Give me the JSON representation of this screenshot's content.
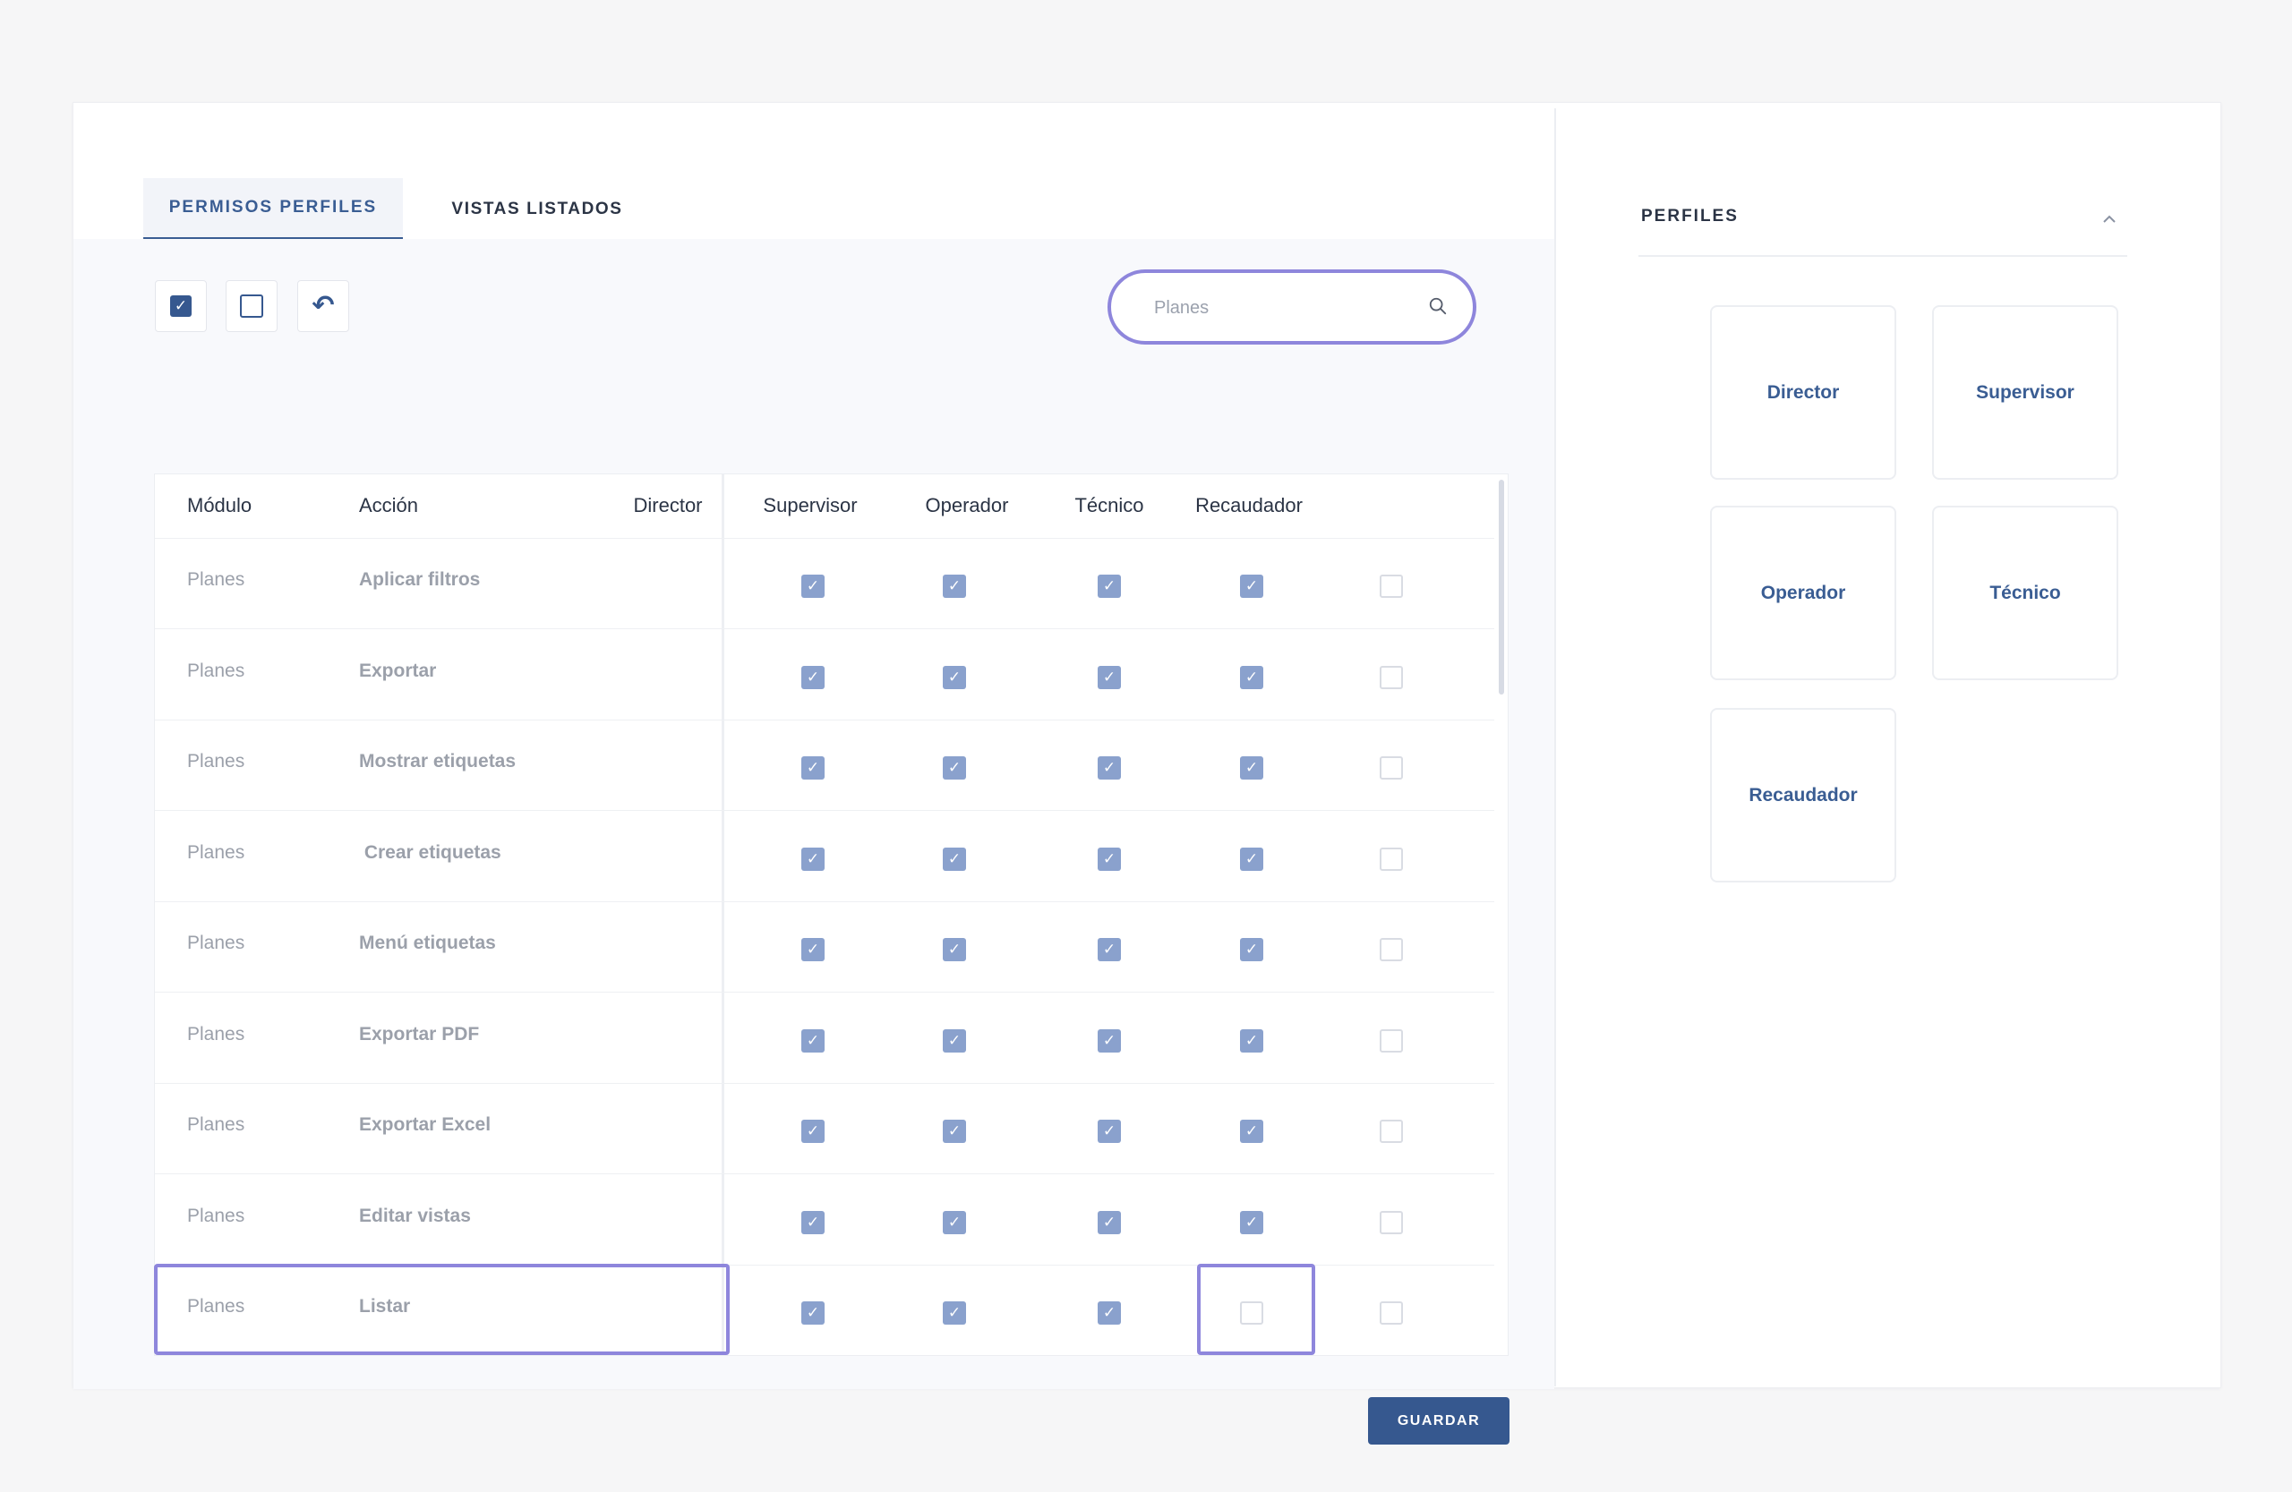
{
  "tabs": {
    "permisos": "PERMISOS PERFILES",
    "vistas": "VISTAS LISTADOS"
  },
  "toolbar": {
    "check_all": "✓",
    "uncheck_all": "",
    "undo": "↶"
  },
  "search": {
    "value": "",
    "placeholder": "Planes"
  },
  "table": {
    "headers": {
      "modulo": "Módulo",
      "accion": "Acción"
    },
    "profiles": [
      "Director",
      "Supervisor",
      "Operador",
      "Técnico",
      "Recaudador"
    ],
    "rows": [
      {
        "modulo": "Planes",
        "accion": "Aplicar filtros",
        "perms": [
          true,
          true,
          true,
          true,
          false
        ]
      },
      {
        "modulo": "Planes",
        "accion": "Exportar",
        "perms": [
          true,
          true,
          true,
          true,
          false
        ]
      },
      {
        "modulo": "Planes",
        "accion": "Mostrar etiquetas",
        "perms": [
          true,
          true,
          true,
          true,
          false
        ]
      },
      {
        "modulo": "Planes",
        "accion": " Crear etiquetas",
        "perms": [
          true,
          true,
          true,
          true,
          false
        ]
      },
      {
        "modulo": "Planes",
        "accion": "Menú etiquetas",
        "perms": [
          true,
          true,
          true,
          true,
          false
        ]
      },
      {
        "modulo": "Planes",
        "accion": "Exportar PDF",
        "perms": [
          true,
          true,
          true,
          true,
          false
        ]
      },
      {
        "modulo": "Planes",
        "accion": "Exportar Excel",
        "perms": [
          true,
          true,
          true,
          true,
          false
        ]
      },
      {
        "modulo": "Planes",
        "accion": "Editar vistas",
        "perms": [
          true,
          true,
          true,
          true,
          false
        ]
      },
      {
        "modulo": "Planes",
        "accion": "Listar",
        "perms": [
          true,
          true,
          true,
          false,
          false
        ]
      }
    ]
  },
  "save_label": "GUARDAR",
  "perfiles": {
    "title": "PERFILES",
    "cards": [
      "Director",
      "Supervisor",
      "Operador",
      "Técnico",
      "Recaudador"
    ]
  },
  "colors": {
    "accent": "#36588f",
    "checked": "#8aa1cd",
    "highlight": "#8e86dc"
  }
}
